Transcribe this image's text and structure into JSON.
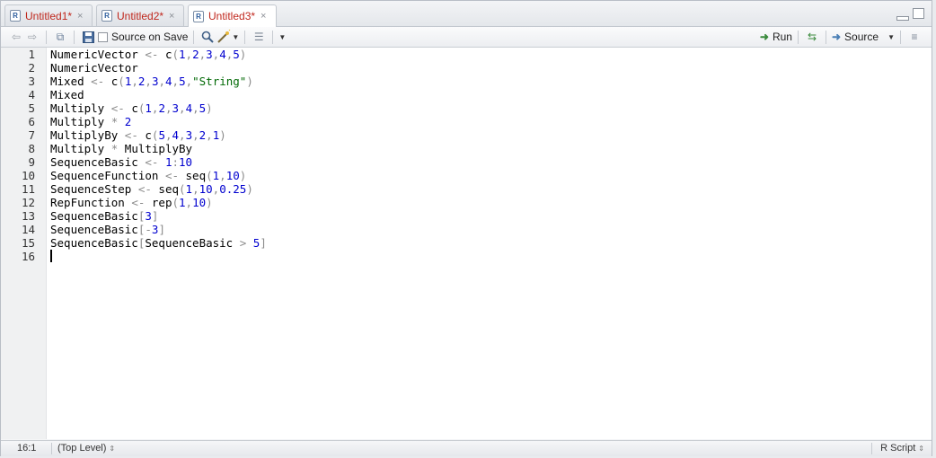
{
  "tabs": [
    {
      "label": "Untitled1*",
      "close": "×",
      "icon": "r-file-icon"
    },
    {
      "label": "Untitled2*",
      "close": "×",
      "icon": "r-file-icon"
    },
    {
      "label": "Untitled3*",
      "close": "×",
      "icon": "r-file-icon"
    }
  ],
  "active_tab": 2,
  "toolbar": {
    "source_on_save": "Source on Save",
    "run": "Run",
    "source": "Source"
  },
  "code_lines": [
    "NumericVector <- c(1,2,3,4,5)",
    "NumericVector",
    "Mixed <- c(1,2,3,4,5,\"String\")",
    "Mixed",
    "Multiply <- c(1,2,3,4,5)",
    "Multiply * 2",
    "MultiplyBy <- c(5,4,3,2,1)",
    "Multiply * MultiplyBy",
    "SequenceBasic <- 1:10",
    "SequenceFunction <- seq(1,10)",
    "SequenceStep <- seq(1,10,0.25)",
    "RepFunction <- rep(1,10)",
    "SequenceBasic[3]",
    "SequenceBasic[-3]",
    "SequenceBasic[SequenceBasic > 5]",
    ""
  ],
  "line_numbers": [
    "1",
    "2",
    "3",
    "4",
    "5",
    "6",
    "7",
    "8",
    "9",
    "10",
    "11",
    "12",
    "13",
    "14",
    "15",
    "16"
  ],
  "status": {
    "cursor_pos": "16:1",
    "scope": "(Top Level)",
    "file_type": "R Script"
  },
  "colors": {
    "tab_label": "#c0271d",
    "number": "#0000cf",
    "string": "#036a07",
    "operator": "#8c8c8c"
  }
}
